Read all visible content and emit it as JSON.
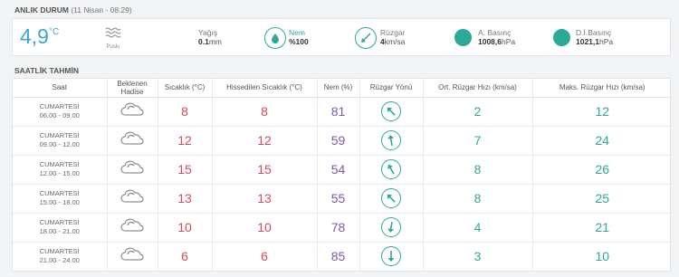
{
  "now": {
    "title": "ANLIK DURUM",
    "date": "(11 Nisan - 08.29)",
    "temp_value": "4,9",
    "temp_unit": "°C",
    "condition_label": "Puslu",
    "condition_icon": "fog-icon",
    "precip": {
      "label": "Yağış",
      "value": "0.1",
      "unit": "mm"
    },
    "humidity": {
      "label": "Nem",
      "value": "%100",
      "icon": "drop-icon"
    },
    "wind": {
      "label": "Rüzgar",
      "value": "4",
      "unit": "km/sa",
      "icon": "wind-arrow-icon"
    },
    "pressure": {
      "label": "A. Basınç",
      "value": "1008,6",
      "unit": "hPa"
    },
    "sea_pressure": {
      "label": "D.İ.Basınç",
      "value": "1021,1",
      "unit": "hPa"
    },
    "accent_color": "#35a7d9",
    "teal_color": "#2aa99a"
  },
  "hourly": {
    "title": "SAATLİK TAHMİN",
    "headers": {
      "time": "Saat",
      "event_1": "Beklenen",
      "event_2": "Hadise",
      "temp": "Sıcaklık (°C)",
      "feels": "Hissedilen Sıcaklık (°C)",
      "humidity": "Nem (%)",
      "wind_dir": "Rüzgar Yönü",
      "wind_avg": "Ort. Rüzgar Hızı (km/sa)",
      "wind_max": "Maks. Rüzgar Hızı (km/sa)"
    },
    "rows": [
      {
        "day": "CUMARTESİ",
        "range": "06.00 - 09.00",
        "event": "cloud-icon",
        "temp": "8",
        "feels": "8",
        "humidity": "81",
        "wind_dir_deg": 135,
        "wind_avg": "2",
        "wind_max": "12"
      },
      {
        "day": "CUMARTESİ",
        "range": "09.00 - 12.00",
        "event": "cloud-icon",
        "temp": "12",
        "feels": "12",
        "humidity": "59",
        "wind_dir_deg": 170,
        "wind_avg": "7",
        "wind_max": "24"
      },
      {
        "day": "CUMARTESİ",
        "range": "12.00 - 15.00",
        "event": "cloud-icon",
        "temp": "15",
        "feels": "15",
        "humidity": "54",
        "wind_dir_deg": 150,
        "wind_avg": "8",
        "wind_max": "26"
      },
      {
        "day": "CUMARTESİ",
        "range": "15.00 - 18.00",
        "event": "cloud-icon",
        "temp": "13",
        "feels": "13",
        "humidity": "55",
        "wind_dir_deg": 135,
        "wind_avg": "8",
        "wind_max": "25"
      },
      {
        "day": "CUMARTESİ",
        "range": "18.00 - 21.00",
        "event": "cloud-icon",
        "temp": "10",
        "feels": "10",
        "humidity": "78",
        "wind_dir_deg": 10,
        "wind_avg": "4",
        "wind_max": "21"
      },
      {
        "day": "CUMARTESİ",
        "range": "21.00 - 24.00",
        "event": "cloud-icon",
        "temp": "6",
        "feels": "6",
        "humidity": "85",
        "wind_dir_deg": 0,
        "wind_avg": "3",
        "wind_max": "10"
      }
    ]
  }
}
